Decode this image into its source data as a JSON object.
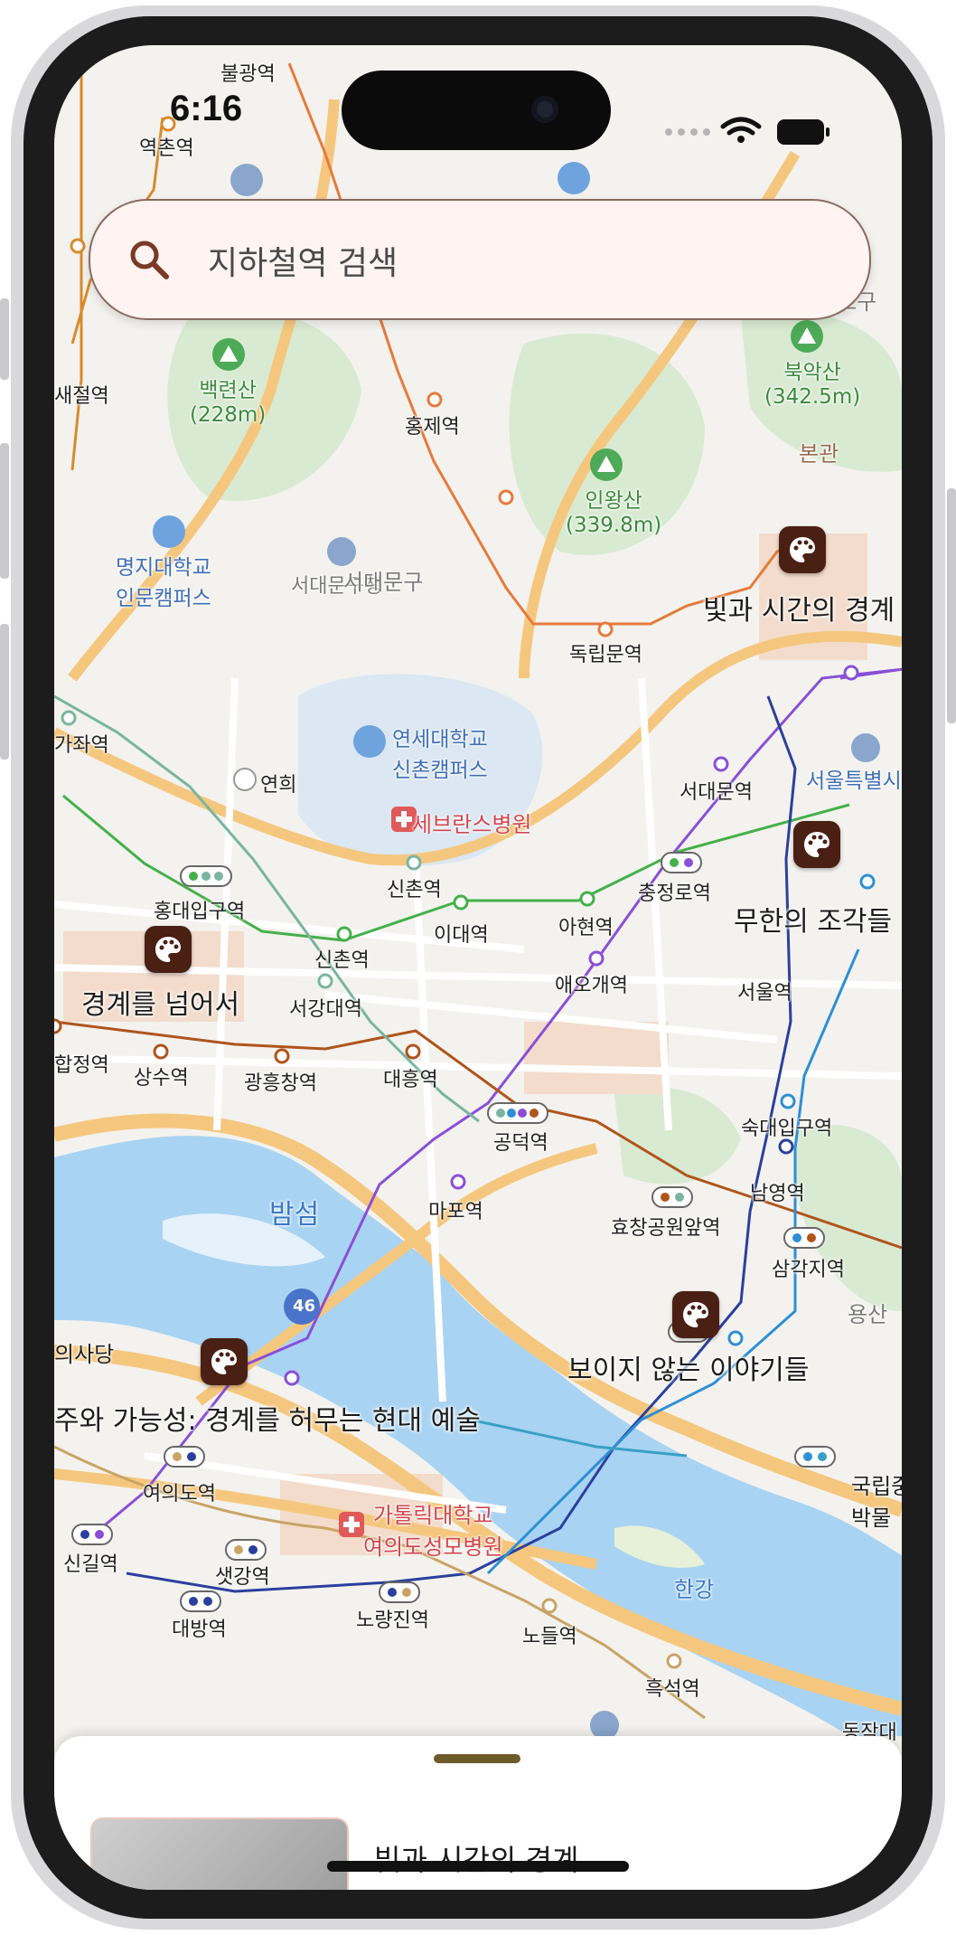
{
  "status_bar": {
    "time": "6:16"
  },
  "search": {
    "placeholder": "지하철역 검색"
  },
  "map": {
    "stations": [
      "불광역",
      "역촌역",
      "홍제역",
      "독립문역",
      "서대문역",
      "충정로역",
      "아현역",
      "이대역",
      "신촌역",
      "신촌역",
      "홍대입구역",
      "애오개역",
      "공덕역",
      "마포역",
      "상수역",
      "광흥창역",
      "대흥역",
      "서강대역",
      "숙대입구역",
      "남영역",
      "효창공원앞역",
      "삼각지역",
      "서울역",
      "여의도역",
      "신길역",
      "샛강역",
      "대방역",
      "노량진역",
      "노들역",
      "흑석역",
      "합정역",
      "새절역",
      "가좌역",
      "동작"
    ],
    "places": {
      "baengnyeonsan": "백련산\n(228m)",
      "inwangsan": "인왕산\n(339.8m)",
      "bugaksan": "북악산\n(342.5m)",
      "myongji": "명지대학교\n인문캠퍼스",
      "seodaemun_office": "서대문구청",
      "seodaemun_gu": "서대문구",
      "yonsei": "연세대학교\n신촌캠퍼스",
      "severance": "세브란스병원",
      "yeonhui_ic": "연희",
      "bamseom": "밤섬",
      "catholic": "가톨릭대학교\n여의도성모병원",
      "hangang": "한강",
      "yongsan": "용산",
      "gukhoe": "의사당",
      "bongwan": "본관",
      "jongno_gu": "로구",
      "seoul_special": "서울특별시",
      "national_museum": "국립중\n박물",
      "road_46": "46",
      "jc": "동작대"
    },
    "exhibitions": [
      {
        "title": "빛과 시간의 경계"
      },
      {
        "title": "무한의 조각들"
      },
      {
        "title": "경계를 넘어서"
      },
      {
        "title": "보이지 않는 이야기들"
      },
      {
        "title": "주와 가능성: 경계를 허무는 현대 예술"
      }
    ]
  },
  "sheet": {
    "title": "빛과 시간의 경계"
  },
  "colors": {
    "pin": "#4a1f14",
    "search_bg": "#fff4f1",
    "water": "#a9d3f2",
    "road": "#f5c77e"
  }
}
